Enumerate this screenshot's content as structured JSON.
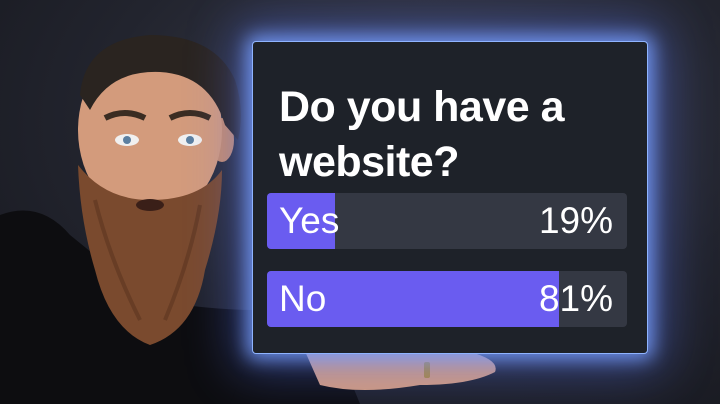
{
  "poll": {
    "question": "Do you have a website?",
    "options": [
      {
        "label": "Yes",
        "percent_text": "19%",
        "fill_fraction": 0.19
      },
      {
        "label": "No",
        "percent_text": "81%",
        "fill_fraction": 0.81
      }
    ]
  },
  "colors": {
    "bar_fill": "#6a5cf0",
    "bar_track": "#343843",
    "card_bg": "#1e2229",
    "glow": "#8fb4ff"
  }
}
